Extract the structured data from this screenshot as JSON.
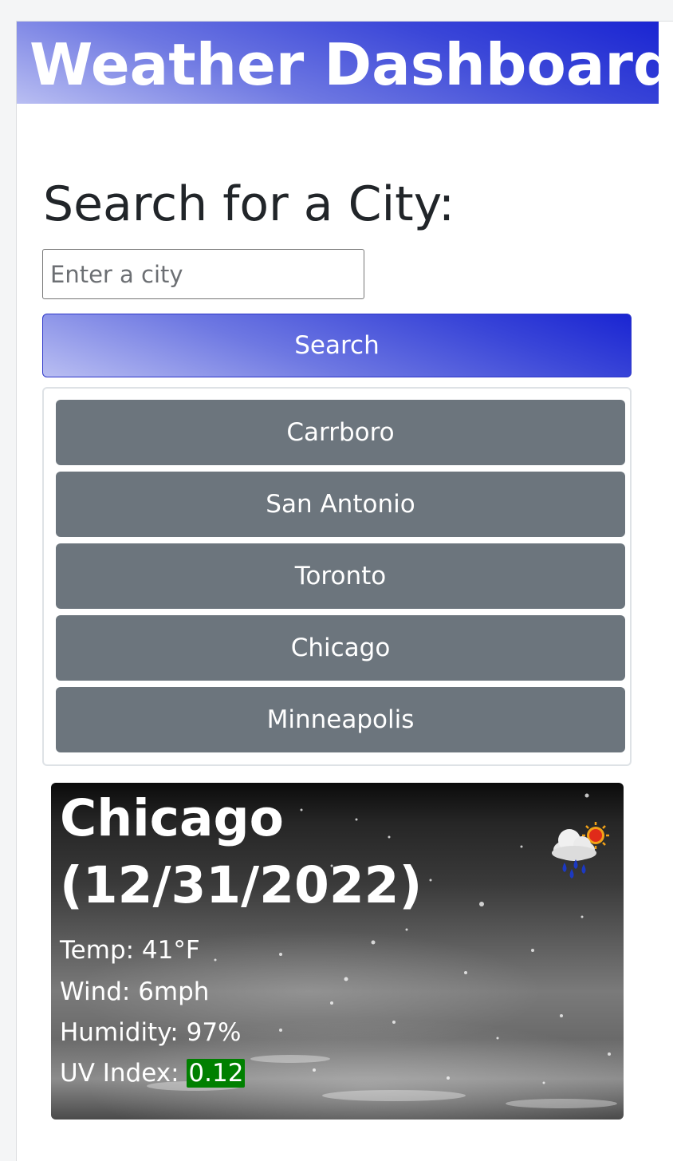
{
  "header": {
    "title": "Weather Dashboard"
  },
  "search": {
    "heading": "Search for a City:",
    "input_value": "",
    "placeholder": "Enter a city",
    "button_label": "Search"
  },
  "history": {
    "cities": [
      "Carrboro",
      "San Antonio",
      "Toronto",
      "Chicago",
      "Minneapolis"
    ]
  },
  "current": {
    "city": "Chicago",
    "date": "(12/31/2022)",
    "temp_label": "Temp: 41°F",
    "wind_label": "Wind: 6mph",
    "humidity_label": "Humidity: 97%",
    "uv_label": "UV Index:",
    "uv_value": "0.12",
    "uv_color": "#008000",
    "icon": "rain-cloud-sun-icon"
  },
  "colors": {
    "accent_start": "#b9bef2",
    "accent_end": "#1a25d2",
    "history_button": "#6c757d"
  }
}
